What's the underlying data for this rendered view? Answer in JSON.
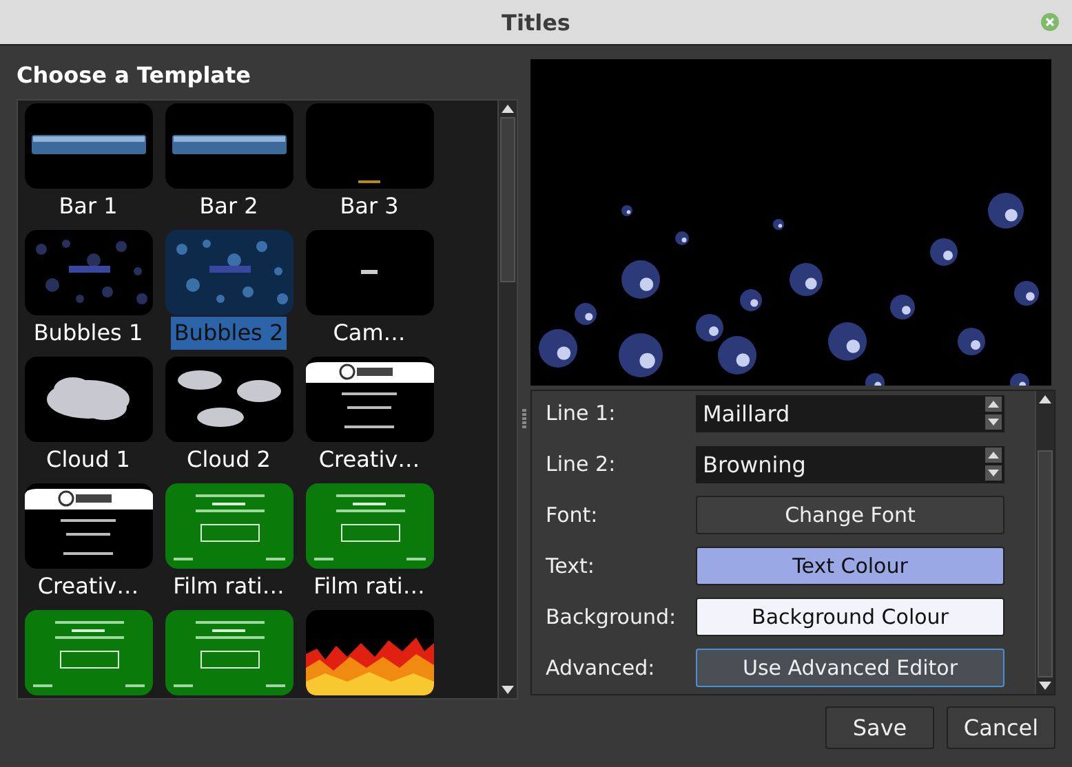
{
  "window": {
    "title": "Titles"
  },
  "template_panel": {
    "heading": "Choose a Template",
    "templates": [
      {
        "label": "Bar 1",
        "selected": false
      },
      {
        "label": "Bar 2",
        "selected": false
      },
      {
        "label": "Bar 3",
        "selected": false
      },
      {
        "label": "Bubbles 1",
        "selected": false
      },
      {
        "label": "Bubbles 2",
        "selected": true
      },
      {
        "label": "Cam…",
        "selected": false
      },
      {
        "label": "Cloud 1",
        "selected": false
      },
      {
        "label": "Cloud 2",
        "selected": false
      },
      {
        "label": "Creativ…",
        "selected": false
      },
      {
        "label": "Creativ…",
        "selected": false
      },
      {
        "label": "Film rati…",
        "selected": false
      },
      {
        "label": "Film rati…",
        "selected": false
      },
      {
        "selected": false
      },
      {
        "selected": false
      },
      {
        "selected": false
      }
    ]
  },
  "properties": [
    {
      "kind": "spin",
      "label": "Line 1:",
      "value": "Maillard"
    },
    {
      "kind": "spin",
      "label": "Line 2:",
      "value": "Browning"
    },
    {
      "kind": "button",
      "label": "Font:",
      "button": "Change Font",
      "focused": false
    },
    {
      "kind": "color",
      "label": "Text:",
      "button": "Text Colour",
      "color": "#9aa9e6",
      "focused": false
    },
    {
      "kind": "color",
      "label": "Background:",
      "button": "Background Colour",
      "color": "#f2f3fb",
      "focused": false
    },
    {
      "kind": "button",
      "label": "Advanced:",
      "button": "Use Advanced Editor",
      "focused": true
    }
  ],
  "buttons": [
    "Save",
    "Cancel"
  ]
}
